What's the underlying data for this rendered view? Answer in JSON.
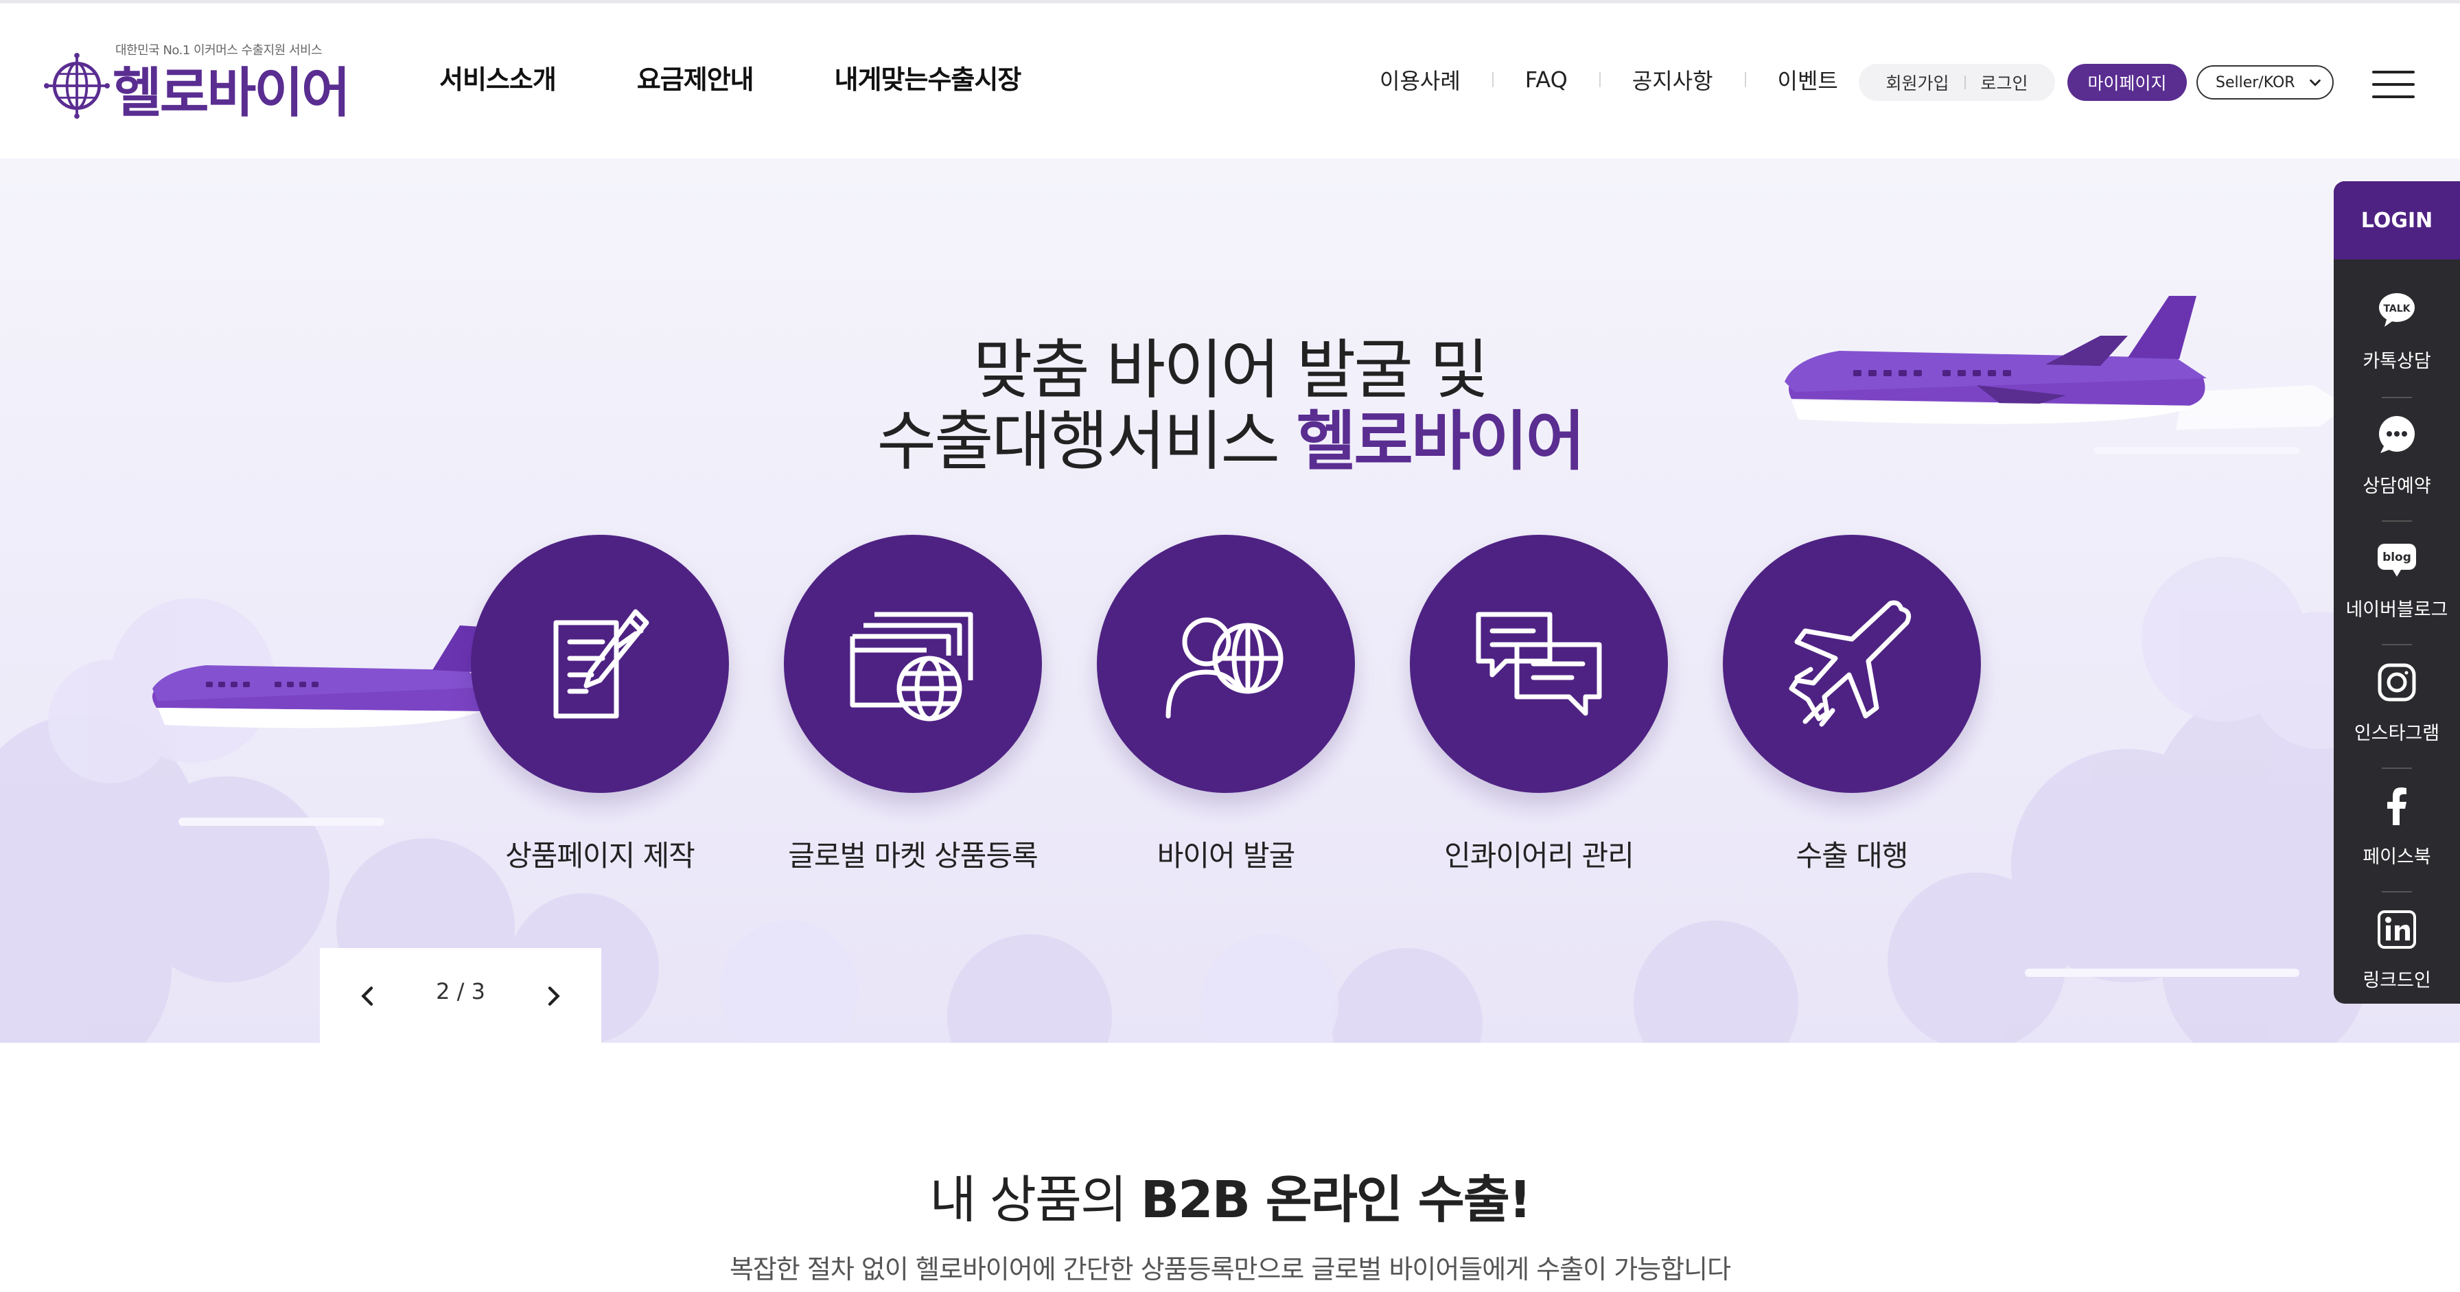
{
  "header": {
    "logo_tagline": "대한민국 No.1 이커머스 수출지원 서비스",
    "logo_text": "헬로바이어",
    "gnb": [
      "서비스소개",
      "요금제안내",
      "내게맞는수출시장"
    ],
    "util": [
      "이용사례",
      "FAQ",
      "공지사항",
      "이벤트"
    ],
    "member": {
      "signup": "회원가입",
      "login": "로그인"
    },
    "mypage": "마이페이지",
    "lang": "Seller/KOR"
  },
  "hero": {
    "title_line1": "맞춤 바이어 발굴 및",
    "title_line2_plain": "수출대행서비스 ",
    "title_line2_brand": "헬로바이어",
    "services": [
      {
        "label": "상품페이지 제작",
        "icon": "document-pen-icon"
      },
      {
        "label": "글로벌 마켓 상품등록",
        "icon": "window-globe-icon"
      },
      {
        "label": "바이어 발굴",
        "icon": "person-globe-icon"
      },
      {
        "label": "인콰이어리 관리",
        "icon": "chat-bubbles-icon"
      },
      {
        "label": "수출 대행",
        "icon": "airplane-icon"
      }
    ],
    "pager": {
      "current": "2",
      "separator": "/",
      "total": "3"
    }
  },
  "quick": {
    "login": "LOGIN",
    "items": [
      {
        "label": "카톡상담",
        "icon": "kakao-talk-icon"
      },
      {
        "label": "상담예약",
        "icon": "chat-dots-icon"
      },
      {
        "label": "네이버블로그",
        "icon": "blog-icon"
      },
      {
        "label": "인스타그램",
        "icon": "instagram-icon"
      },
      {
        "label": "페이스북",
        "icon": "facebook-icon"
      },
      {
        "label": "링크드인",
        "icon": "linkedin-icon"
      }
    ]
  },
  "section2": {
    "title_plain": "내 상품의 ",
    "title_bold": "B2B 온라인 수출!",
    "subtitle": "복잡한 절차 없이 헬로바이어에 간단한 상품등록만으로 글로벌 바이어들에게 수출이 가능합니다"
  },
  "colors": {
    "brand": "#5a2d91",
    "circle": "#4e2283",
    "quickbar": "#2b2b2f"
  }
}
